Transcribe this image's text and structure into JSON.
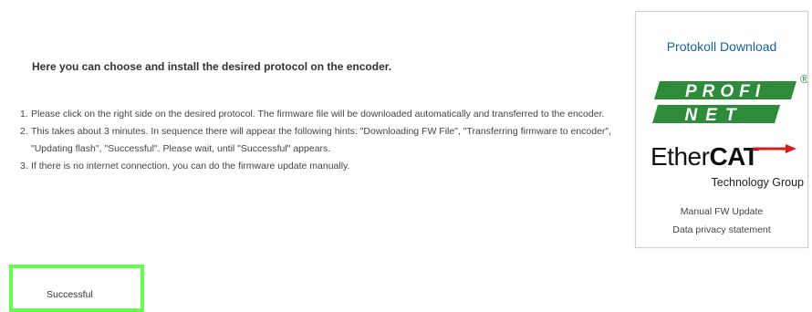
{
  "intro": {
    "heading": "Here you can choose and install the desired protocol on the encoder."
  },
  "steps": [
    {
      "number": "1.",
      "text": "Please click on the right side on the desired protocol. The firmware file will be downloaded automatically and transferred to the encoder."
    },
    {
      "number": "2.",
      "text": "This takes about 3 minutes. In sequence there will appear the following hints: \"Downloading FW File\", \"Transferring firmware to encoder\", \"Updating flash\", \"Successful\". Please wait, until \"Successful\" appears."
    },
    {
      "number": "3.",
      "text": "If there is no internet connection, you can do the firmware update manually."
    }
  ],
  "panel": {
    "title": "Protokoll Download",
    "profinet": {
      "top_text": "PROFI",
      "bottom_text": "NET",
      "registered": "®",
      "color": "#2e8b3a"
    },
    "ethercat": {
      "ether": "Ether",
      "cat": "CAT",
      "subtitle": "Technology Group",
      "arrow_color": "#d91d1d"
    },
    "manual_update": "Manual FW Update",
    "privacy": "Data privacy statement"
  },
  "status": {
    "text": "Successful",
    "highlight_color": "#66ff4d"
  }
}
